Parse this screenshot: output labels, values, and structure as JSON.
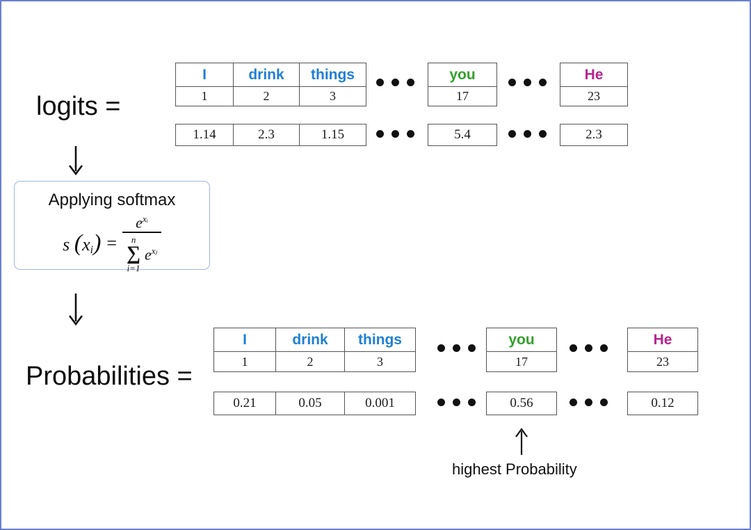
{
  "diagram": {
    "title_logits": "logits =",
    "title_probabilities": "Probabilities =",
    "caption_highest": "highest Probability",
    "softmax": {
      "heading": "Applying softmax",
      "lhs_s": "s",
      "lhs_open": "(",
      "lhs_x": "x",
      "lhs_sub": "i",
      "lhs_close": ")",
      "equals": "=",
      "numerator_base": "e",
      "numerator_sup": "xᵢ",
      "sigma_symbol": "∑",
      "sigma_upper": "n",
      "sigma_lower": "i=1",
      "den_base": "e",
      "den_sup": "xⱼ"
    },
    "colors": {
      "token_blue": "#1f7fd4",
      "token_green": "#33a02c",
      "token_purple": "#b5268f",
      "cell_border": "#555555",
      "page_border": "#6b7fd0",
      "softmax_border": "#9fb6e8"
    },
    "ellipsis": "• • •"
  },
  "logits_row": {
    "group_left": {
      "tokens": [
        "I",
        "drink",
        "things"
      ],
      "indices": [
        "1",
        "2",
        "3"
      ],
      "values": [
        "1.14",
        "2.3",
        "1.15"
      ]
    },
    "group_you": {
      "tokens": [
        "you"
      ],
      "indices": [
        "17"
      ],
      "values": [
        "5.4"
      ]
    },
    "group_he": {
      "tokens": [
        "He"
      ],
      "indices": [
        "23"
      ],
      "values": [
        "2.3"
      ]
    }
  },
  "probabilities_row": {
    "group_left": {
      "tokens": [
        "I",
        "drink",
        "things"
      ],
      "indices": [
        "1",
        "2",
        "3"
      ],
      "values": [
        "0.21",
        "0.05",
        "0.001"
      ]
    },
    "group_you": {
      "tokens": [
        "you"
      ],
      "indices": [
        "17"
      ],
      "values": [
        "0.56"
      ]
    },
    "group_he": {
      "tokens": [
        "He"
      ],
      "indices": [
        "23"
      ],
      "values": [
        "0.12"
      ]
    }
  }
}
